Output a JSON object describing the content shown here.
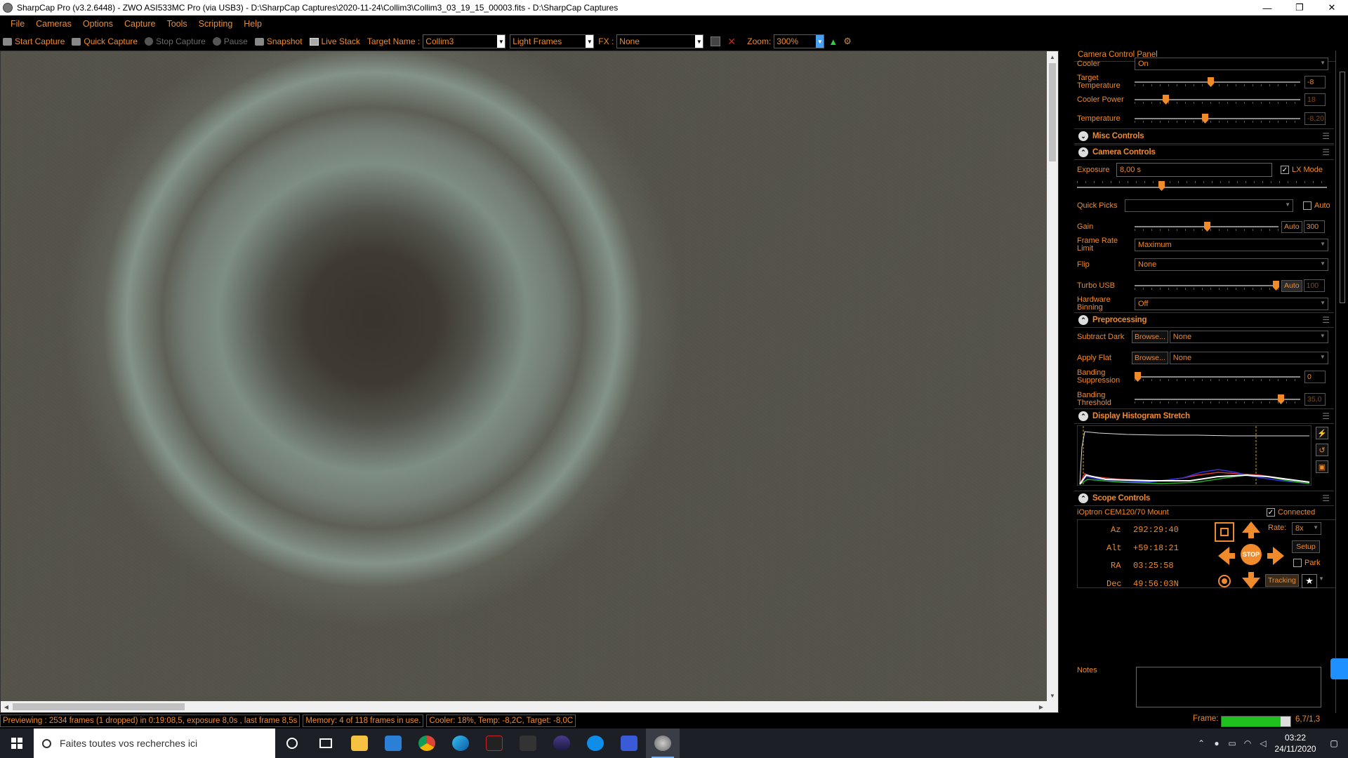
{
  "window": {
    "title": "SharpCap Pro (v3.2.6448) - ZWO ASI533MC Pro (via USB3) - D:\\SharpCap Captures\\2020-11-24\\Collim3\\Collim3_03_19_15_00003.fits - D:\\SharpCap Captures",
    "controls": [
      "—",
      "❐",
      "✕"
    ]
  },
  "menu": [
    "File",
    "Cameras",
    "Options",
    "Capture",
    "Tools",
    "Scripting",
    "Help"
  ],
  "toolbar": {
    "start_capture": "Start Capture",
    "quick_capture": "Quick Capture",
    "stop_capture": "Stop Capture",
    "pause": "Pause",
    "snapshot": "Snapshot",
    "live_stack": "Live Stack",
    "target_name_label": "Target Name :",
    "target_name_value": "Collim3",
    "frame_type": "Light Frames",
    "fx_label": "FX :",
    "fx_value": "None",
    "zoom_label": "Zoom:",
    "zoom_value": "300%"
  },
  "panel": {
    "title": "Camera Control Panel",
    "cooler": {
      "cooler_label": "Cooler",
      "cooler_value": "On",
      "target_temp_label": "Target Temperature",
      "target_temp_value": "-8",
      "cooler_power_label": "Cooler Power",
      "cooler_power_value": "18",
      "temperature_label": "Temperature",
      "temperature_value": "-8,20"
    },
    "misc_controls": "Misc Controls",
    "camera_controls": {
      "header": "Camera Controls",
      "exposure_label": "Exposure",
      "exposure_value": "8,00 s",
      "lx_mode_label": "LX Mode",
      "lx_mode_checked": true,
      "quick_picks_label": "Quick Picks",
      "quick_picks_value": "",
      "auto_label": "Auto",
      "gain_label": "Gain",
      "gain_auto": "Auto",
      "gain_value": "300",
      "frame_rate_label": "Frame Rate Limit",
      "frame_rate_value": "Maximum",
      "flip_label": "Flip",
      "flip_value": "None",
      "turbo_label": "Turbo USB",
      "turbo_auto": "Auto",
      "turbo_value": "100",
      "binning_label": "Hardware Binning",
      "binning_value": "Off"
    },
    "preprocessing": {
      "header": "Preprocessing",
      "subtract_dark_label": "Subtract Dark",
      "browse_label": "Browse...",
      "subtract_dark_value": "None",
      "apply_flat_label": "Apply Flat",
      "apply_flat_value": "None",
      "banding_supp_label": "Banding Suppression",
      "banding_supp_value": "0",
      "banding_thresh_label": "Banding Threshold",
      "banding_thresh_value": "35,0"
    },
    "histogram": {
      "header": "Display Histogram Stretch"
    },
    "scope": {
      "header": "Scope Controls",
      "mount": "iOptron CEM120/70 Mount",
      "connected_label": "Connected",
      "az_label": "Az",
      "az_value": "292:29:40",
      "alt_label": "Alt",
      "alt_value": "+59:18:21",
      "ra_label": "RA",
      "ra_value": "03:25:58",
      "dec_label": "Dec",
      "dec_value": "49:56:03N",
      "rate_label": "Rate:",
      "rate_value": "8x",
      "setup_label": "Setup",
      "park_label": "Park",
      "tracking_label": "Tracking",
      "stop_label": "STOP"
    },
    "notes_label": "Notes"
  },
  "status": {
    "previewing": "Previewing : 2534 frames (1 dropped) in 0:19:08,5, exposure 8,0s , last frame 8,5s",
    "memory": "Memory: 4 of 118 frames in use.",
    "cooler": "Cooler: 18%, Temp: -8,2C, Target: -8,0C",
    "frame_label": "Frame:",
    "frame_value": "6,7/1,3",
    "frame_progress": 0.86
  },
  "taskbar": {
    "search_placeholder": "Faites toutes vos recherches ici",
    "time": "03:22",
    "date": "24/11/2020"
  },
  "colors": {
    "accent": "#f08a2a",
    "background": "#000000",
    "frame_bar": "#1fc11f"
  }
}
